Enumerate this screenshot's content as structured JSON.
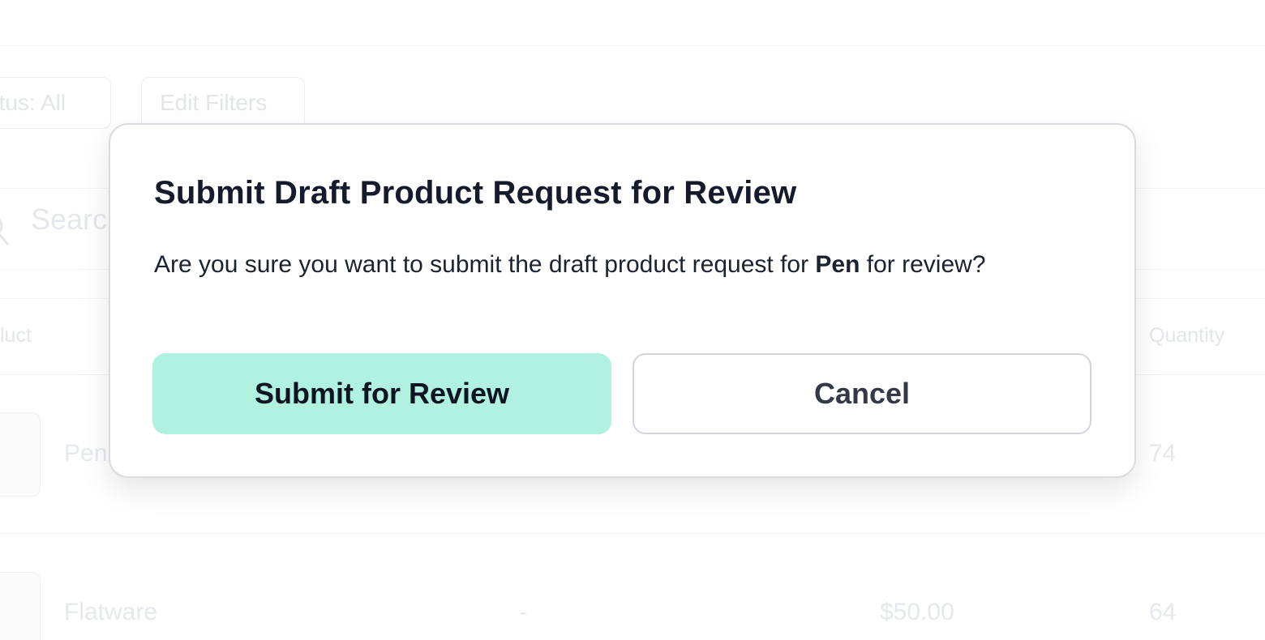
{
  "background": {
    "filters": {
      "status_label": "atus: All",
      "edit_filters_label": "Edit Filters"
    },
    "search": {
      "placeholder": "Searc"
    },
    "table": {
      "headers": {
        "product": "luct",
        "quantity": "Quantity"
      },
      "rows": [
        {
          "name": "Pen",
          "code": "",
          "price": "",
          "quantity": "74"
        },
        {
          "name": "Flatware",
          "code": "-",
          "price": "$50.00",
          "quantity": "64"
        }
      ]
    }
  },
  "dialog": {
    "title": "Submit Draft Product Request for Review",
    "body_prefix": "Are you sure you want to submit the draft product request for ",
    "product_name": "Pen",
    "body_suffix": " for review?",
    "primary_button": "Submit for Review",
    "secondary_button": "Cancel",
    "colors": {
      "primary_button_bg": "#b0f2df",
      "title_text": "#151b2b",
      "border": "#d9dcdf"
    }
  }
}
